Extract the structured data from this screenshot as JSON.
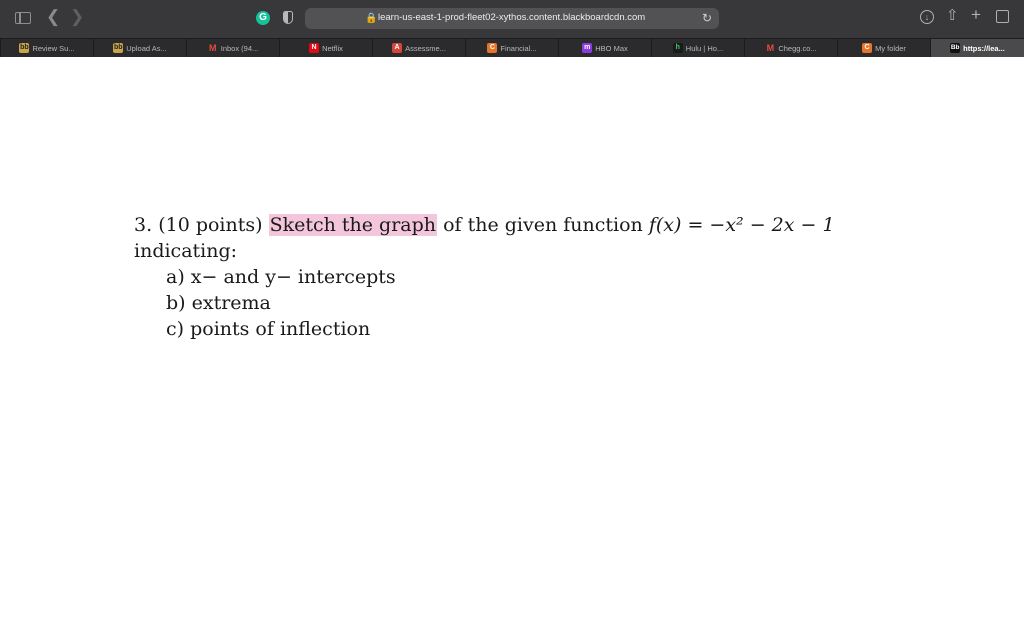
{
  "browser": {
    "url": "learn-us-east-1-prod-fleet02-xythos.content.blackboardcdn.com",
    "icons": [
      "sidebar-icon",
      "back-icon",
      "forward-icon",
      "grammarly-icon",
      "privacy-shield-icon",
      "lock-icon",
      "reload-icon",
      "download-icon",
      "share-icon",
      "new-tab-icon",
      "tab-overview-icon"
    ]
  },
  "bookmarks": [
    {
      "label": "Review Su...",
      "favicon": "bb"
    },
    {
      "label": "Upload As...",
      "favicon": "bb"
    },
    {
      "label": "Inbox (94...",
      "favicon": "M"
    },
    {
      "label": "Netflix",
      "favicon": "N"
    },
    {
      "label": "Assessme...",
      "favicon": "A"
    },
    {
      "label": "Financial...",
      "favicon": "C"
    },
    {
      "label": "HBO Max",
      "favicon": "m"
    },
    {
      "label": "Hulu | Ho...",
      "favicon": "h"
    },
    {
      "label": "Chegg.co...",
      "favicon": "M"
    },
    {
      "label": "My folder",
      "favicon": "C"
    },
    {
      "label": "https://lea...",
      "favicon": "Bb"
    }
  ],
  "problem": {
    "number": "3.",
    "points": "(10 points)",
    "highlight": "Sketch the graph",
    "rest": "of the given function",
    "function": "f(x) = −x² − 2x − 1",
    "indicating": "indicating:",
    "items": [
      "a) x− and y− intercepts",
      "b) extrema",
      "c) points of inflection"
    ]
  }
}
